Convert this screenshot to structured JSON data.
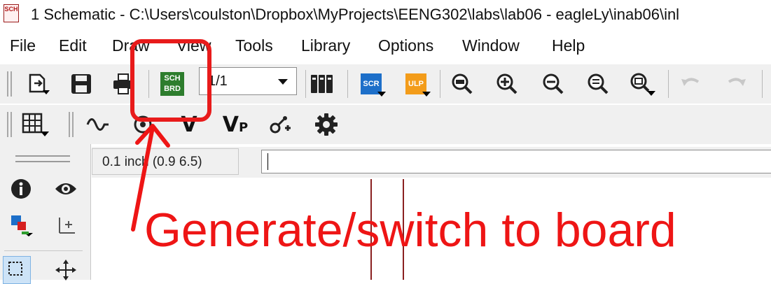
{
  "window": {
    "app_icon_text": "SCH",
    "title": "1 Schematic - C:\\Users\\coulston\\Dropbox\\MyProjects\\EENG302\\labs\\lab06 - eagleLy\\inab06\\inl"
  },
  "menu": {
    "items": [
      "File",
      "Edit",
      "Draw",
      "View",
      "Tools",
      "Library",
      "Options",
      "Window",
      "Help"
    ]
  },
  "toolbar1": {
    "icons": [
      "open-icon",
      "save-icon",
      "print-icon",
      "sch-brd-switch-icon",
      "cam-icon",
      "script-icon",
      "ulp-icon",
      "zoom-fit-icon",
      "zoom-in-icon",
      "zoom-out-icon",
      "zoom-select-icon",
      "zoom-window-icon",
      "undo-icon",
      "redo-icon"
    ],
    "sch_brd": {
      "top": "SCH",
      "bottom": "BRD",
      "color": "#2d7d2d"
    },
    "sheet_select": {
      "value": "1/1"
    },
    "scr_label": "SCR",
    "ulp_label": "ULP",
    "scr_color": "#1d6fc9",
    "ulp_color": "#f39c1a"
  },
  "toolbar2": {
    "icons": [
      "grid-icon",
      "erc-icon",
      "drc-icon",
      "v-icon",
      "vp-icon",
      "add-net-icon",
      "settings-gear-icon"
    ],
    "v_label": "V",
    "vp_label": "V",
    "vp_sub": "P"
  },
  "statusbar": {
    "coordinates": "0.1 inch (0.9 6.5)",
    "command_value": ""
  },
  "annotation": {
    "text": "Generate/switch to board",
    "color": "#ee1515"
  }
}
